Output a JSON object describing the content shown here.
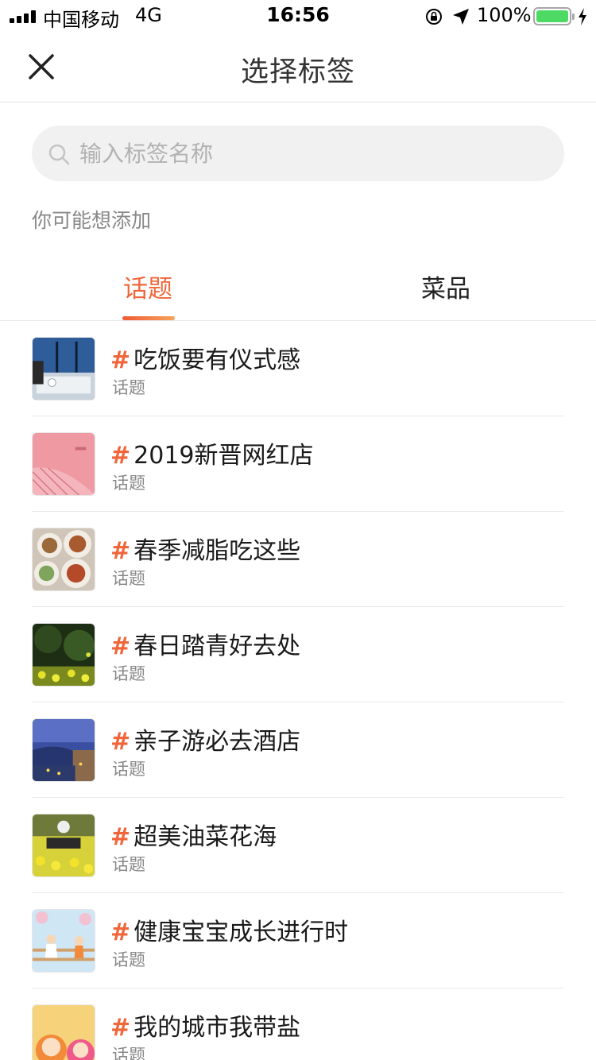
{
  "status_bar": {
    "carrier": "中国移动",
    "network": "4G",
    "time": "16:56",
    "battery": "100%",
    "battery_color": "#4cd964"
  },
  "nav": {
    "title": "选择标签",
    "close_icon": "close-icon"
  },
  "search": {
    "placeholder": "输入标签名称",
    "value": ""
  },
  "hint": "你可能想添加",
  "tabs": [
    {
      "label": "话题",
      "active": true
    },
    {
      "label": "菜品",
      "active": false
    }
  ],
  "accent_color": "#f0663a",
  "hash_symbol": "#",
  "items": [
    {
      "title": "吃饭要有仪式感",
      "type": "话题"
    },
    {
      "title": "2019新晋网红店",
      "type": "话题"
    },
    {
      "title": "春季减脂吃这些",
      "type": "话题"
    },
    {
      "title": "春日踏青好去处",
      "type": "话题"
    },
    {
      "title": "亲子游必去酒店",
      "type": "话题"
    },
    {
      "title": "超美油菜花海",
      "type": "话题"
    },
    {
      "title": "健康宝宝成长进行时",
      "type": "话题"
    },
    {
      "title": "我的城市我带盐",
      "type": "话题"
    }
  ]
}
